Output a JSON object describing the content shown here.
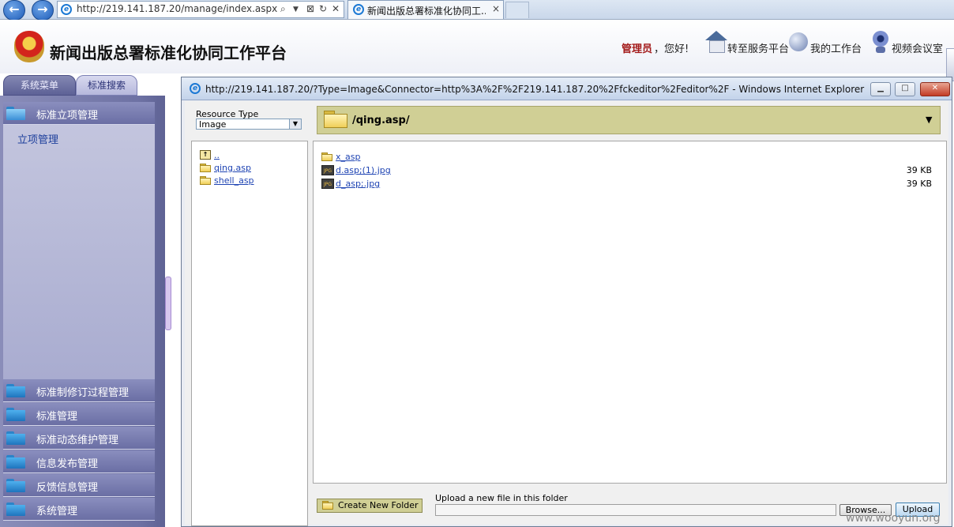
{
  "browser": {
    "address_url": "http://219.141.187.20/manage/index.aspx",
    "tab_title": "新闻出版总署标准化协同工...",
    "tab_close": "×",
    "back": "←",
    "forward": "→",
    "search_glyph": "⌕",
    "refresh_glyph": "↻",
    "stop_glyph": "✕"
  },
  "header": {
    "site_title": "新闻出版总署标准化协同工作平台",
    "user_role": "管理员",
    "greeting": "，您好!",
    "links": {
      "service": "转至服务平台",
      "workbench": "我的工作台",
      "video": "视频会议室"
    }
  },
  "sidebar": {
    "tabs": [
      "系统菜单",
      "标准搜索"
    ],
    "active_item": "标准立项管理",
    "sub_items": [
      "立项管理"
    ],
    "items": [
      "标准制修订过程管理",
      "标准管理",
      "标准动态维护管理",
      "信息发布管理",
      "反馈信息管理",
      "系统管理"
    ]
  },
  "dialog": {
    "title": "http://219.141.187.20/?Type=Image&Connector=http%3A%2F%2F219.141.187.20%2Ffckeditor%2Feditor%2F - Windows Internet Explorer",
    "resource_type_label": "Resource Type",
    "resource_type_value": "Image",
    "current_path": "/qing.asp/",
    "tree": [
      {
        "name": "..",
        "kind": "up"
      },
      {
        "name": "qing.asp",
        "kind": "folder"
      },
      {
        "name": "shell_asp",
        "kind": "folder"
      }
    ],
    "files": [
      {
        "name": "x_asp",
        "kind": "folder",
        "size": ""
      },
      {
        "name": "d.asp;(1).jpg",
        "kind": "jpg",
        "size": "39 KB"
      },
      {
        "name": "d_asp;.jpg",
        "kind": "jpg",
        "size": "39 KB"
      }
    ],
    "create_folder_label": "Create New Folder",
    "upload_label": "Upload a new file in this folder",
    "browse_label": "Browse...",
    "upload_button": "Upload"
  },
  "watermark": "www.wooyun.org",
  "colors": {
    "sidebar": "#6d71a3",
    "path_bar": "#d0cf95",
    "link": "#1f44b3",
    "role": "#a31b1b"
  }
}
